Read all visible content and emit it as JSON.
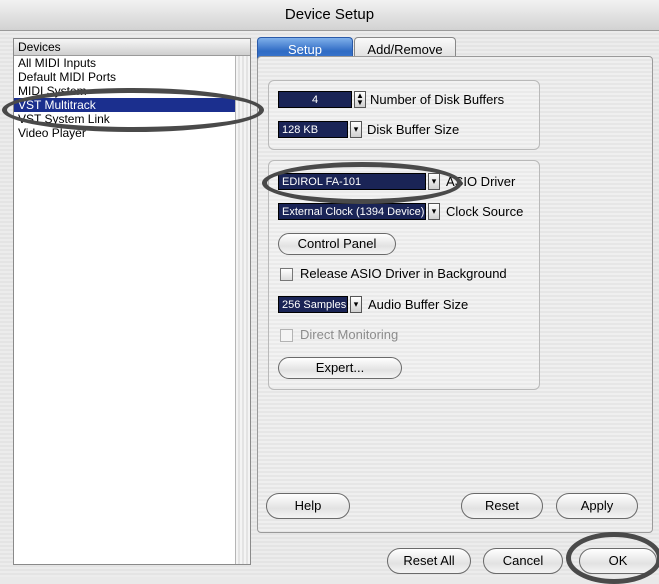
{
  "window": {
    "title": "Device Setup"
  },
  "device_list": {
    "header": "Devices",
    "items": [
      {
        "label": "All MIDI Inputs",
        "selected": false
      },
      {
        "label": "Default MIDI Ports",
        "selected": false
      },
      {
        "label": "MIDI System",
        "selected": false
      },
      {
        "label": "VST Multitrack",
        "selected": true
      },
      {
        "label": "VST System Link",
        "selected": false
      },
      {
        "label": "Video Player",
        "selected": false
      }
    ]
  },
  "tabs": {
    "setup": "Setup",
    "add_remove": "Add/Remove"
  },
  "disk": {
    "buffers_value": "4",
    "buffers_label": "Number of Disk Buffers",
    "buffer_size_value": "128 KB",
    "buffer_size_label": "Disk Buffer Size"
  },
  "asio": {
    "driver_value": "EDIROL FA-101",
    "driver_label": "ASIO Driver",
    "clock_value": "External Clock (1394 Device)",
    "clock_label": "Clock Source",
    "control_panel_label": "Control Panel",
    "release_label": "Release ASIO Driver in Background",
    "buffer_value": "256 Samples",
    "buffer_label": "Audio Buffer Size",
    "direct_monitoring_label": "Direct Monitoring",
    "expert_label": "Expert..."
  },
  "panel_buttons": {
    "help": "Help",
    "reset": "Reset",
    "apply": "Apply"
  },
  "dialog_buttons": {
    "reset_all": "Reset All",
    "cancel": "Cancel",
    "ok": "OK"
  },
  "colors": {
    "selection": "#1b2f8e",
    "field": "#1a2456",
    "tab_active": "#2f6bc4"
  }
}
